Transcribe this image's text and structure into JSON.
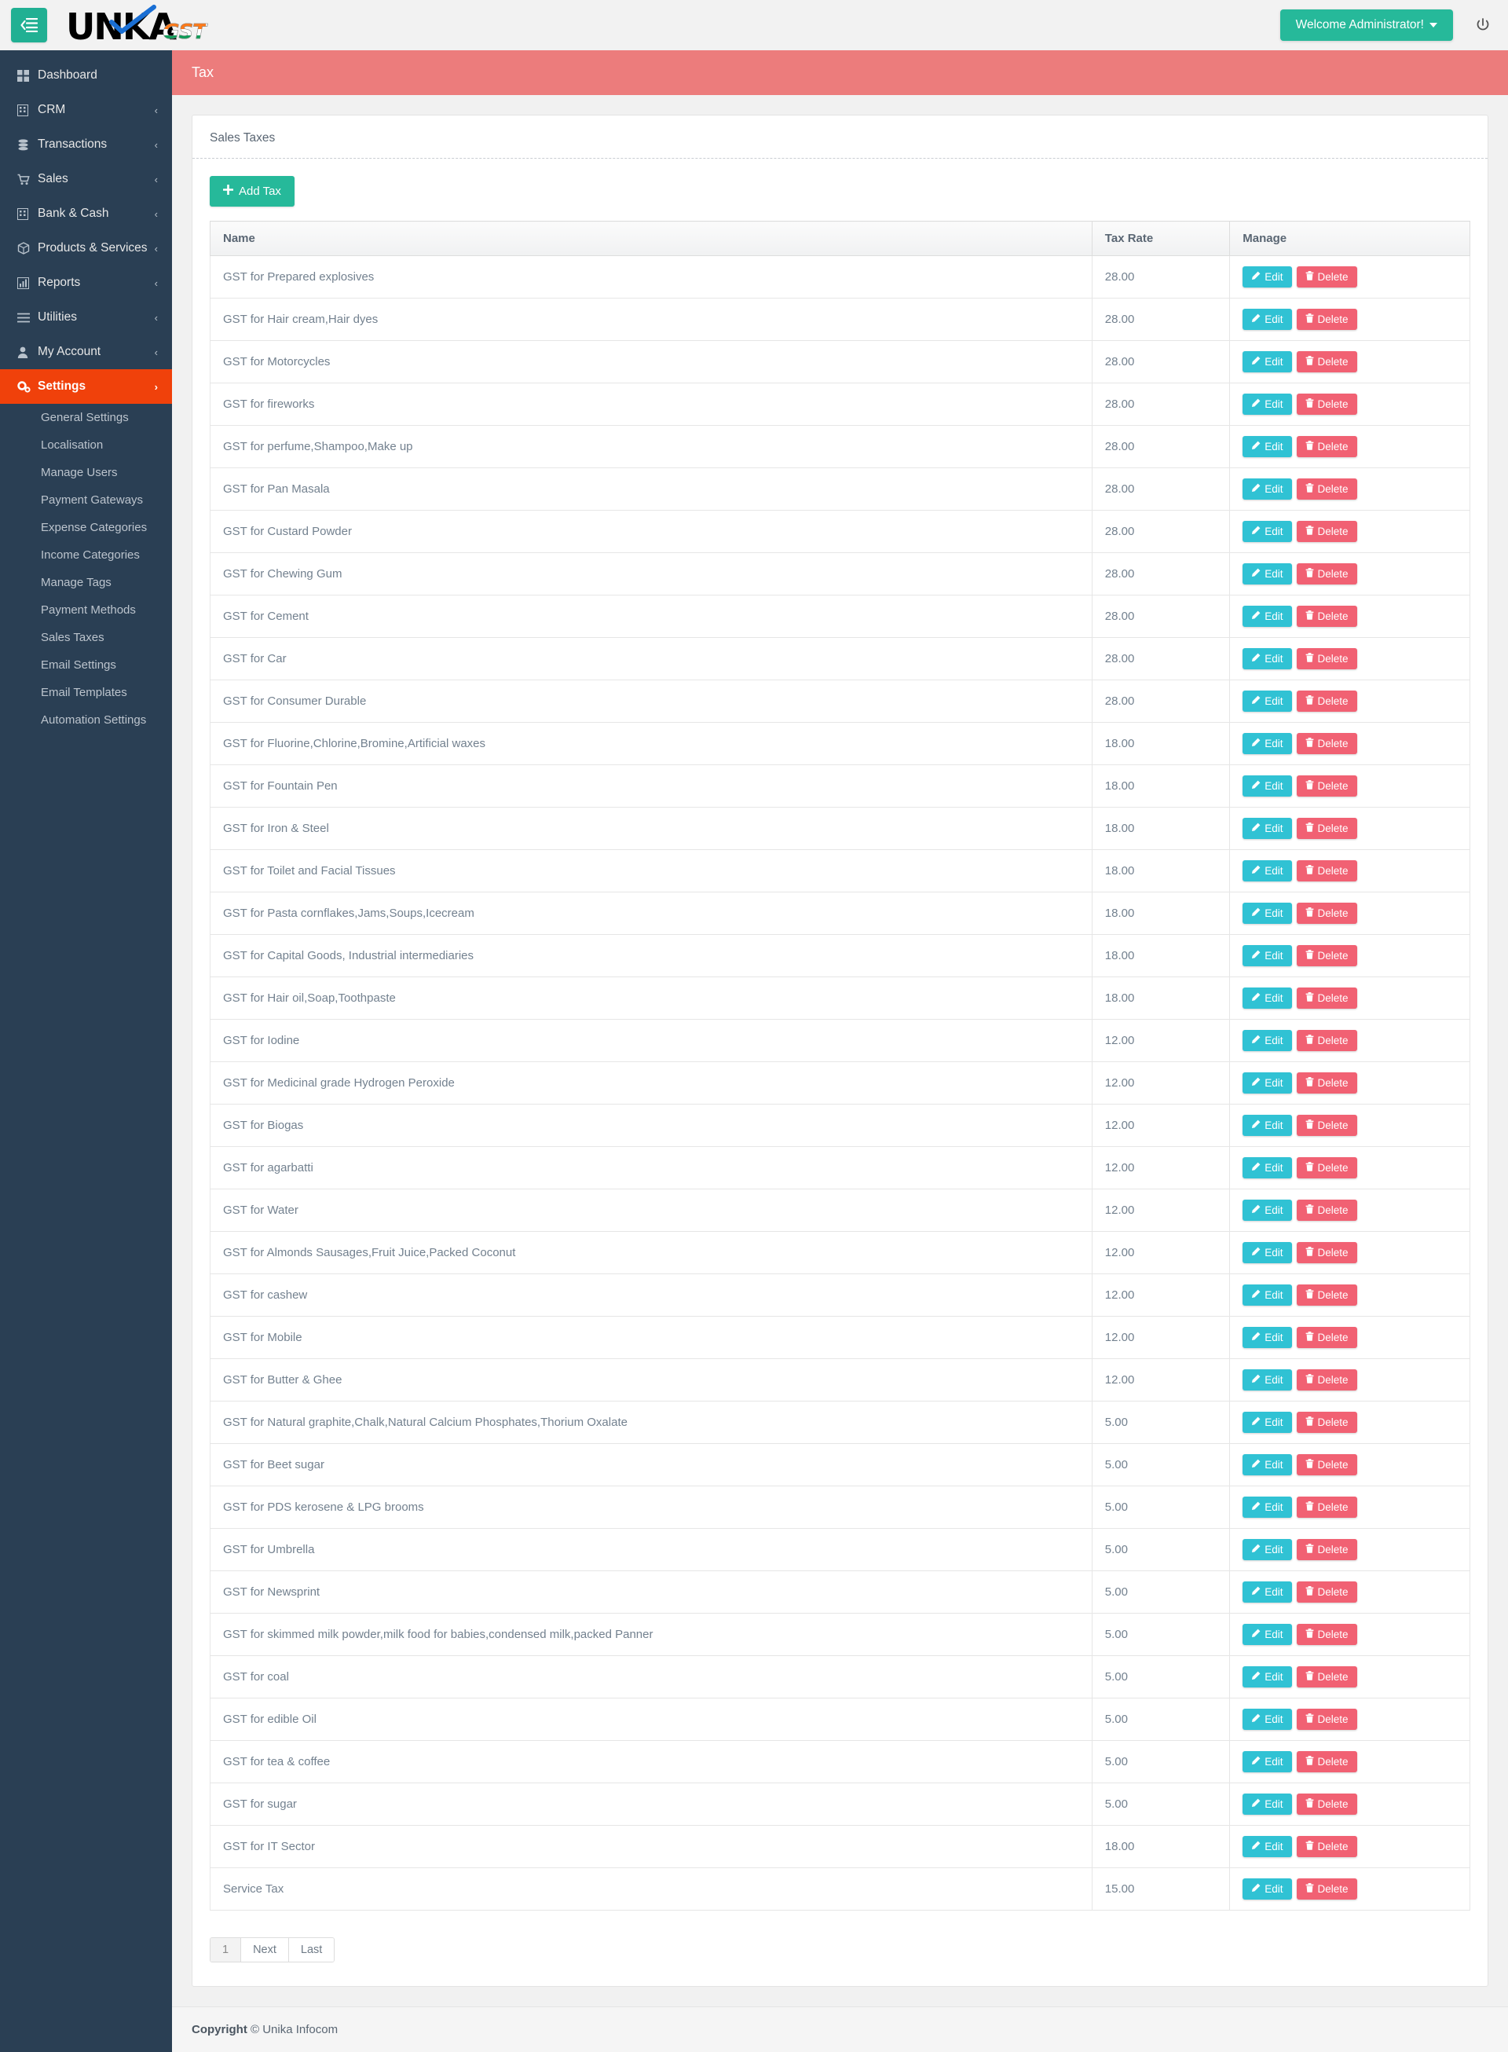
{
  "topbar": {
    "toggle_icon": "sidebar-toggle-icon",
    "logo_primary": "UNKA",
    "logo_secondary": "GST",
    "welcome_label": "Welcome Administrator!",
    "power_icon": "power-icon",
    "accent_green": "#26b99a"
  },
  "sidebar": {
    "items": [
      {
        "label": "Dashboard",
        "icon": "grid-icon",
        "has_chevron": false,
        "active": false
      },
      {
        "label": "CRM",
        "icon": "building-icon",
        "has_chevron": true,
        "active": false
      },
      {
        "label": "Transactions",
        "icon": "database-icon",
        "has_chevron": true,
        "active": false
      },
      {
        "label": "Sales",
        "icon": "cart-icon",
        "has_chevron": true,
        "active": false
      },
      {
        "label": "Bank & Cash",
        "icon": "bank-icon",
        "has_chevron": true,
        "active": false
      },
      {
        "label": "Products & Services",
        "icon": "box-icon",
        "has_chevron": true,
        "active": false
      },
      {
        "label": "Reports",
        "icon": "bar-chart-icon",
        "has_chevron": true,
        "active": false
      },
      {
        "label": "Utilities",
        "icon": "list-icon",
        "has_chevron": true,
        "active": false
      },
      {
        "label": "My Account",
        "icon": "user-icon",
        "has_chevron": true,
        "active": false
      },
      {
        "label": "Settings",
        "icon": "gears-icon",
        "has_chevron": true,
        "active": true
      }
    ],
    "active_color": "#f0410b",
    "sub_items": [
      "General Settings",
      "Localisation",
      "Manage Users",
      "Payment Gateways",
      "Expense Categories",
      "Income Categories",
      "Manage Tags",
      "Payment Methods",
      "Sales Taxes",
      "Email Settings",
      "Email Templates",
      "Automation Settings"
    ]
  },
  "page": {
    "banner_title": "Tax",
    "banner_color": "#ec7c7c",
    "panel_title": "Sales Taxes",
    "add_button_label": "Add Tax",
    "add_button_icon": "plus-icon"
  },
  "table": {
    "columns": [
      "Name",
      "Tax Rate",
      "Manage"
    ],
    "edit_label": "Edit",
    "delete_label": "Delete",
    "edit_icon": "pencil-icon",
    "delete_icon": "trash-icon",
    "rows": [
      {
        "name": "GST for Prepared explosives",
        "rate": "28.00"
      },
      {
        "name": "GST for Hair cream,Hair dyes",
        "rate": "28.00"
      },
      {
        "name": "GST for Motorcycles",
        "rate": "28.00"
      },
      {
        "name": "GST for fireworks",
        "rate": "28.00"
      },
      {
        "name": "GST for perfume,Shampoo,Make up",
        "rate": "28.00"
      },
      {
        "name": "GST for Pan Masala",
        "rate": "28.00"
      },
      {
        "name": "GST for Custard Powder",
        "rate": "28.00"
      },
      {
        "name": "GST for Chewing Gum",
        "rate": "28.00"
      },
      {
        "name": "GST for Cement",
        "rate": "28.00"
      },
      {
        "name": "GST for Car",
        "rate": "28.00"
      },
      {
        "name": "GST for Consumer Durable",
        "rate": "28.00"
      },
      {
        "name": "GST for Fluorine,Chlorine,Bromine,Artificial waxes",
        "rate": "18.00"
      },
      {
        "name": "GST for Fountain Pen",
        "rate": "18.00"
      },
      {
        "name": "GST for Iron & Steel",
        "rate": "18.00"
      },
      {
        "name": "GST for Toilet and Facial Tissues",
        "rate": "18.00"
      },
      {
        "name": "GST for Pasta cornflakes,Jams,Soups,Icecream",
        "rate": "18.00"
      },
      {
        "name": "GST for Capital Goods, Industrial intermediaries",
        "rate": "18.00"
      },
      {
        "name": "GST for Hair oil,Soap,Toothpaste",
        "rate": "18.00"
      },
      {
        "name": "GST for Iodine",
        "rate": "12.00"
      },
      {
        "name": "GST for Medicinal grade Hydrogen Peroxide",
        "rate": "12.00"
      },
      {
        "name": "GST for Biogas",
        "rate": "12.00"
      },
      {
        "name": "GST for agarbatti",
        "rate": "12.00"
      },
      {
        "name": "GST for Water",
        "rate": "12.00"
      },
      {
        "name": "GST for Almonds Sausages,Fruit Juice,Packed Coconut",
        "rate": "12.00"
      },
      {
        "name": "GST for cashew",
        "rate": "12.00"
      },
      {
        "name": "GST for Mobile",
        "rate": "12.00"
      },
      {
        "name": "GST for Butter & Ghee",
        "rate": "12.00"
      },
      {
        "name": "GST for Natural graphite,Chalk,Natural Calcium Phosphates,Thorium Oxalate",
        "rate": "5.00"
      },
      {
        "name": "GST for Beet sugar",
        "rate": "5.00"
      },
      {
        "name": "GST for PDS kerosene & LPG brooms",
        "rate": "5.00"
      },
      {
        "name": "GST for Umbrella",
        "rate": "5.00"
      },
      {
        "name": "GST for Newsprint",
        "rate": "5.00"
      },
      {
        "name": "GST for skimmed milk powder,milk food for babies,condensed milk,packed Panner",
        "rate": "5.00"
      },
      {
        "name": "GST for coal",
        "rate": "5.00"
      },
      {
        "name": "GST for edible Oil",
        "rate": "5.00"
      },
      {
        "name": "GST for tea & coffee",
        "rate": "5.00"
      },
      {
        "name": "GST for sugar",
        "rate": "5.00"
      },
      {
        "name": "GST for IT Sector",
        "rate": "18.00"
      },
      {
        "name": "Service Tax",
        "rate": "15.00"
      }
    ]
  },
  "pagination": {
    "items": [
      {
        "label": "1",
        "current": true
      },
      {
        "label": "Next",
        "current": false
      },
      {
        "label": "Last",
        "current": false
      }
    ]
  },
  "footer": {
    "copyright_bold": "Copyright",
    "copyright_rest": "© Unika Infocom"
  }
}
